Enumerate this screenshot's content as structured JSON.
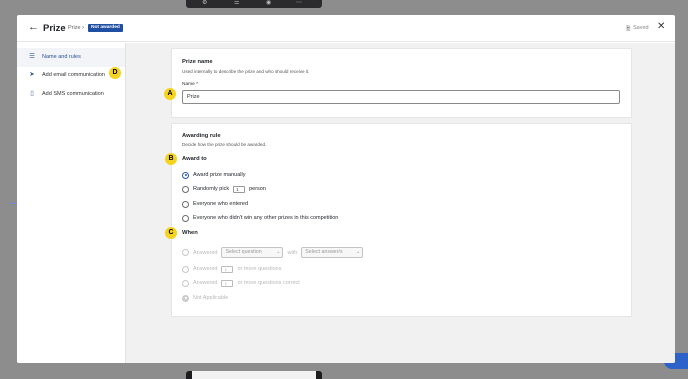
{
  "header": {
    "title": "Prize",
    "breadcrumb": "Prize",
    "separator": "›",
    "status_badge": "Not awarded",
    "saved_label": "Saved",
    "back_icon": "arrow-left-icon",
    "close_icon": "close-icon",
    "saved_icon": "save-icon"
  },
  "sidebar": {
    "items": [
      {
        "label": "Name and rules",
        "icon": "list-icon",
        "active": true
      },
      {
        "label": "Add email communication",
        "icon": "send-icon",
        "active": false
      },
      {
        "label": "Add SMS communication",
        "icon": "phone-icon",
        "active": false
      }
    ]
  },
  "prize_name": {
    "heading": "Prize name",
    "description": "Used internally to describe the prize and who should receive it.",
    "field_label": "Name *",
    "field_value": "Prize"
  },
  "awarding_rule": {
    "heading": "Awarding rule",
    "description": "Decide how the prize should be awarded.",
    "award_to": {
      "label": "Award to",
      "options": [
        {
          "label": "Award prize manually",
          "selected": true
        },
        {
          "label_before": "Randomly pick",
          "value": "1",
          "label_after": "person",
          "selected": false
        },
        {
          "label": "Everyone who entered",
          "selected": false
        },
        {
          "label": "Everyone who didn't win any other prizes in this competition",
          "selected": false
        }
      ]
    },
    "when": {
      "label": "When",
      "options": [
        {
          "label_before": "Answered",
          "select1": "Select question",
          "with": "with",
          "select2": "Select answer/s"
        },
        {
          "label_before": "Answered",
          "value": "1",
          "label_after": "or more questions"
        },
        {
          "label_before": "Answered",
          "value": "1",
          "label_after": "or more questions correct"
        },
        {
          "label": "Not Applicable",
          "selected": true
        }
      ]
    }
  },
  "markers": {
    "a": "A",
    "b": "B",
    "c": "C",
    "d": "D"
  },
  "colors": {
    "accent": "#2a5ab8",
    "badge": "#1f4fa3",
    "marker": "#f5d31f"
  }
}
